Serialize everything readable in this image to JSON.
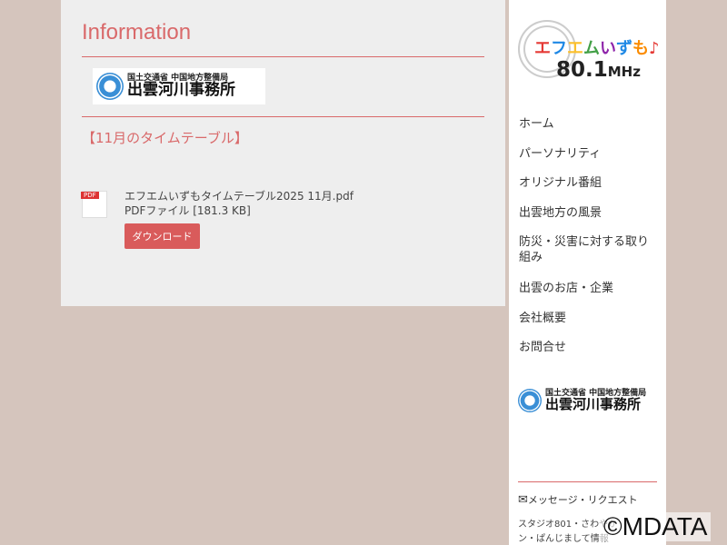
{
  "main": {
    "title": "Information",
    "office_logo": {
      "line1": "国土交通省 中国地方整備局",
      "line2": "出雲河川事務所"
    },
    "section_heading": "【11月のタイムテーブル】",
    "file": {
      "icon_label": "PDF",
      "name": "エフエムいずもタイムテーブル2025  11月.pdf",
      "meta": "PDFファイル [181.3 KB]",
      "download": "ダウンロード"
    }
  },
  "sidebar": {
    "station_logo": {
      "name": "エフエムいずも♪",
      "freq": "80.1",
      "unit": "MHz"
    },
    "nav": [
      "ホーム",
      "パーソナリティ",
      "オリジナル番組",
      "出雲地方の風景",
      "防災・災害に対する取り組み",
      "出雲のお店・企業",
      "会社概要",
      "お問合せ"
    ],
    "office_logo": {
      "line1": "国土交通省 中国地方整備局",
      "line2": "出雲河川事務所"
    },
    "message": "メッセージ・リクエスト",
    "text_lines": [
      "スタジオ801・さわやか",
      "ン・ぱんじまして情報"
    ]
  },
  "watermark": "©MDATA"
}
